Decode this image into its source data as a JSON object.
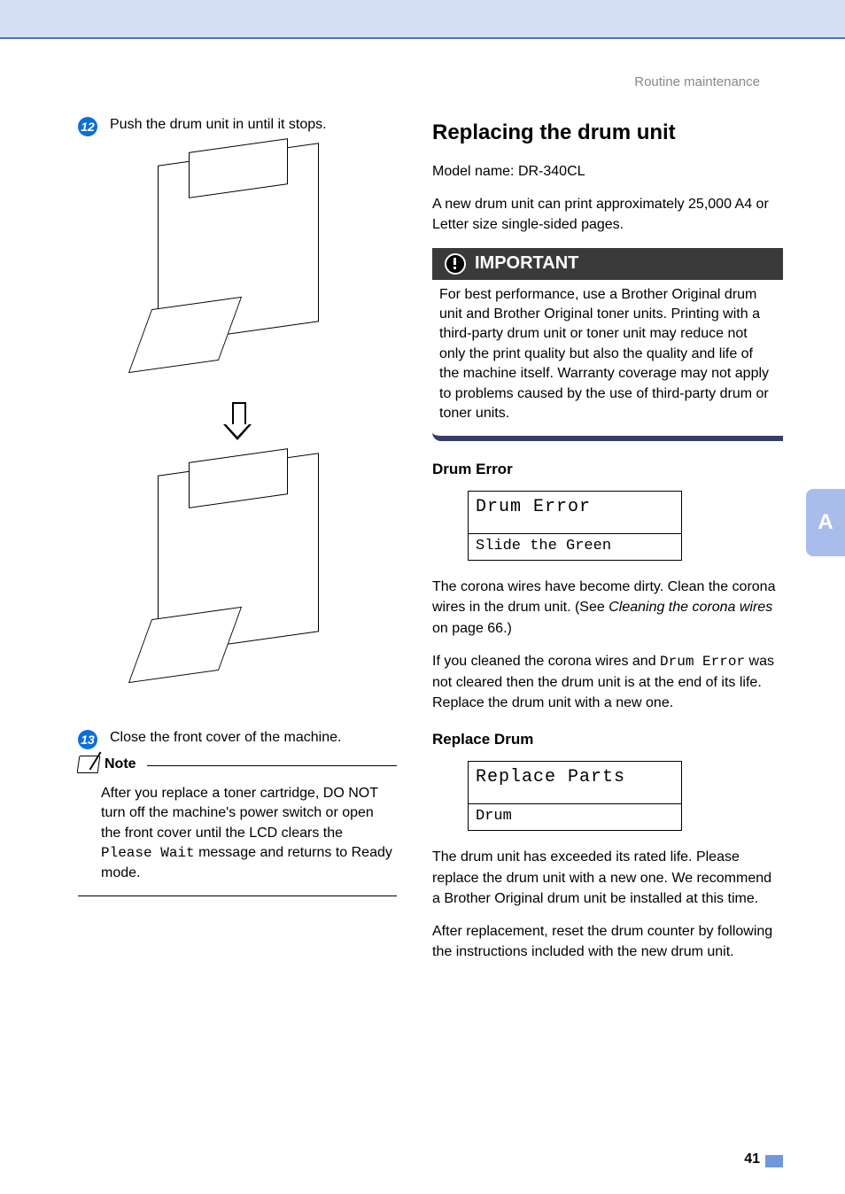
{
  "header": {
    "breadcrumb": "Routine maintenance"
  },
  "left": {
    "step12": {
      "num": "12",
      "text": "Push the drum unit in until it stops."
    },
    "step13": {
      "num": "13",
      "text": "Close the front cover of the machine."
    },
    "note": {
      "label": "Note",
      "body_pre": "After you replace a toner cartridge, DO NOT turn off the machine's power switch or open the front cover until the LCD clears the ",
      "body_mono": "Please Wait",
      "body_post": " message and returns to Ready mode."
    }
  },
  "right": {
    "title": "Replacing the drum unit",
    "model": "Model name: DR-340CL",
    "intro": "A new drum unit can print approximately 25,000 A4 or Letter size single-sided pages.",
    "important": {
      "label": "IMPORTANT",
      "body": "For best performance, use a Brother Original drum unit and Brother Original toner units. Printing with a third-party drum unit or toner unit may reduce not only the print quality but also the quality and life of the machine itself. Warranty coverage may not apply to problems caused by the use of third-party drum or toner units."
    },
    "drum_error": {
      "title": "Drum Error",
      "lcd_top": "Drum Error",
      "lcd_bottom": "Slide the Green",
      "p1_pre": "The corona wires have become dirty. Clean the corona wires in the drum unit. (See ",
      "p1_italic": "Cleaning the corona wires",
      "p1_post": " on page 66.)",
      "p2_pre": "If you cleaned the corona wires and ",
      "p2_mono": "Drum Error",
      "p2_post": " was not cleared then the drum unit is at the end of its life. Replace the drum unit with a new one."
    },
    "replace_drum": {
      "title": "Replace Drum",
      "lcd_top": "Replace Parts",
      "lcd_bottom": "Drum",
      "p1": "The drum unit has exceeded its rated life. Please replace the drum unit with a new one. We recommend a Brother Original drum unit be installed at this time.",
      "p2": "After replacement, reset the drum counter by following the instructions included with the new drum unit."
    }
  },
  "side_tab": "A",
  "page_number": "41"
}
